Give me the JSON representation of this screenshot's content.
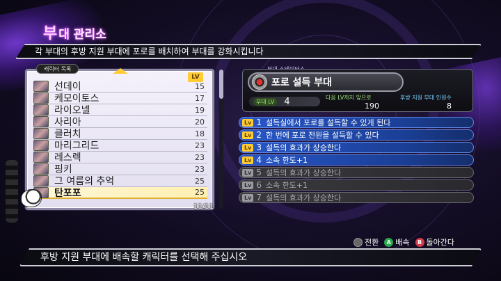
{
  "screen": {
    "title_big": "부",
    "title_rest": "대 관리소",
    "info_text": "각 부대의 후방 지원 부대에 포로를 배치하여 부대를 강화시킵니다",
    "help_text": "후방 지원 부대에 배속할 캐릭터를 선택해 주십시오"
  },
  "list": {
    "header": "캐릭터 목록",
    "lv_header": "LV",
    "page_counter": "11/11",
    "items": [
      {
        "name": "선데이",
        "lv": "15"
      },
      {
        "name": "케모이토스",
        "lv": "17"
      },
      {
        "name": "라이오넬",
        "lv": "19"
      },
      {
        "name": "사리아",
        "lv": "20"
      },
      {
        "name": "클러치",
        "lv": "18"
      },
      {
        "name": "마리그리드",
        "lv": "23"
      },
      {
        "name": "레스렉",
        "lv": "23"
      },
      {
        "name": "핑키",
        "lv": "23"
      },
      {
        "name": "그 여름의 추억",
        "lv": "25"
      },
      {
        "name": "탄포포",
        "lv": "25"
      }
    ]
  },
  "squad": {
    "status_label": "부대 스테이터스",
    "name": "포로 설득 부대",
    "lv_label": "부대 LV",
    "lv_value": "4",
    "next_label": "다음 LV까지 앞으로",
    "next_value": "190",
    "support_label": "후방 지원 부대 인원수",
    "support_value": "8"
  },
  "skills": [
    {
      "tag": "Lv",
      "num": "1",
      "text": "설득실에서 포로를 설득할 수 있게 된다",
      "unlocked": true
    },
    {
      "tag": "Lv",
      "num": "2",
      "text": "한 번에 포로 전원을 설득할 수 있다",
      "unlocked": true
    },
    {
      "tag": "Lv",
      "num": "3",
      "text": "설득의 효과가 상승한다",
      "unlocked": true
    },
    {
      "tag": "Lv",
      "num": "4",
      "text": "소속 한도+1",
      "unlocked": true
    },
    {
      "tag": "Lv",
      "num": "5",
      "text": "설득의 효과가 상승한다",
      "unlocked": false
    },
    {
      "tag": "Lv",
      "num": "6",
      "text": "소속 한도+1",
      "unlocked": false
    },
    {
      "tag": "Lv",
      "num": "7",
      "text": "설득의 효과가 상승한다",
      "unlocked": false
    }
  ],
  "hints": {
    "switch_label": "전환",
    "assign_btn": "A",
    "assign_label": "배속",
    "back_btn": "B",
    "back_label": "돌아간다"
  },
  "colors": {
    "accent_unlocked": "#2757c9",
    "accent_locked": "#3a3a3f",
    "lv_tag": "#ffcc33",
    "title_glow": "#d060ff"
  }
}
